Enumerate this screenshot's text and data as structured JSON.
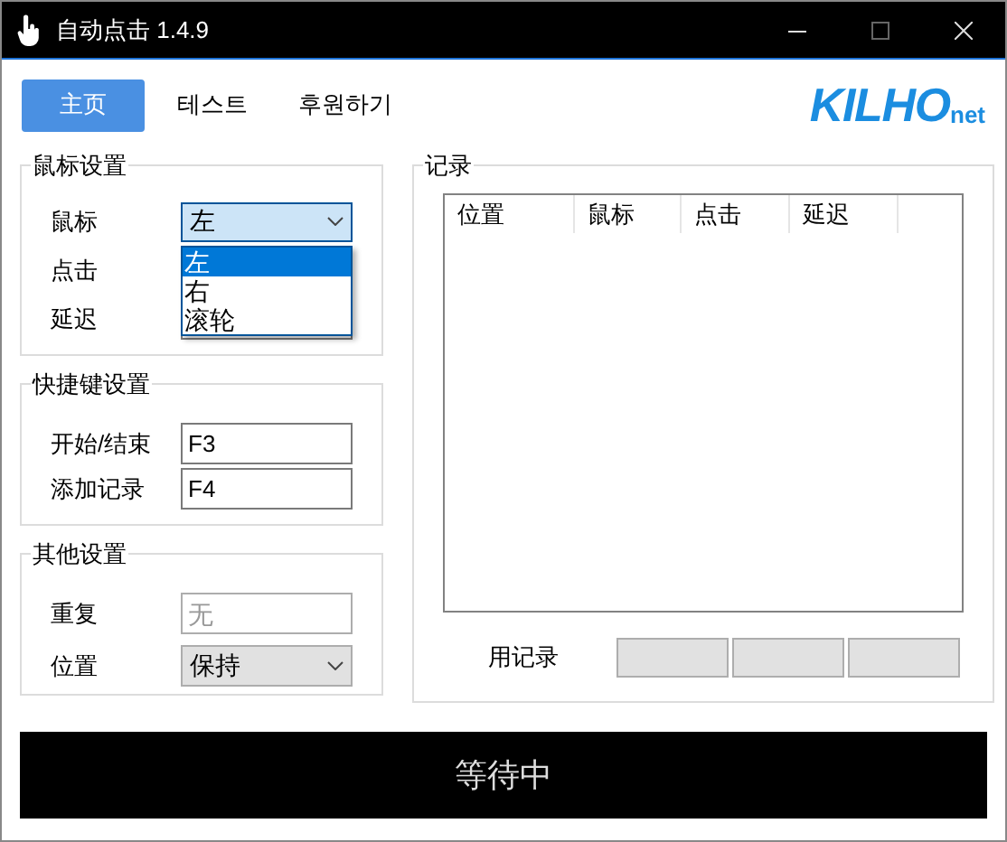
{
  "window": {
    "title": "自动点击 1.4.9"
  },
  "tabs": [
    {
      "label": "主页",
      "selected": true
    },
    {
      "label": "테스트",
      "selected": false
    },
    {
      "label": "후원하기",
      "selected": false
    }
  ],
  "logo": {
    "text": "KILHO",
    "suffix": "net"
  },
  "mouse_settings": {
    "title": "鼠标设置",
    "rows": [
      {
        "label": "鼠标"
      },
      {
        "label": "点击"
      },
      {
        "label": "延迟"
      }
    ],
    "mouse_select": {
      "value": "左",
      "expanded": true,
      "options": [
        {
          "label": "左",
          "selected": true
        },
        {
          "label": "右",
          "selected": false
        },
        {
          "label": "滚轮",
          "selected": false
        }
      ]
    }
  },
  "hotkey_settings": {
    "title": "快捷键设置",
    "rows": [
      {
        "label": "开始/结束",
        "value": "F3"
      },
      {
        "label": "添加记录",
        "value": "F4"
      }
    ]
  },
  "other_settings": {
    "title": "其他设置",
    "rows": [
      {
        "label": "重复",
        "kind": "input",
        "placeholder": "无"
      },
      {
        "label": "位置",
        "kind": "select",
        "value": "保持"
      }
    ]
  },
  "records": {
    "title": "记录",
    "columns": [
      "位置",
      "鼠标",
      "点击",
      "延迟"
    ],
    "record_label": "用记录",
    "buttons": [
      {
        "kind": "button"
      },
      {
        "kind": "button"
      },
      {
        "kind": "button"
      }
    ]
  },
  "status_bar": {
    "text": "等待中"
  }
}
